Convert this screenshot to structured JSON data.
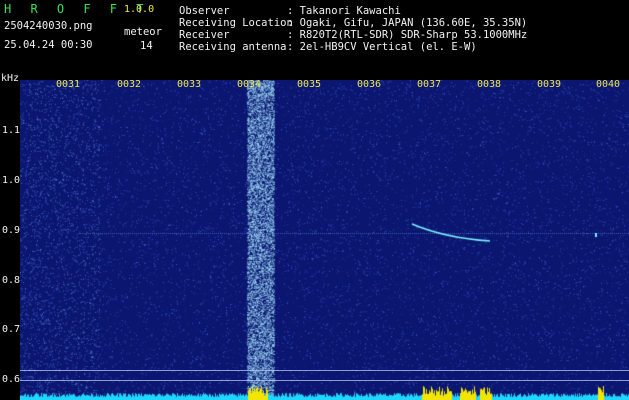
{
  "header": {
    "app_name": "H R O F F T",
    "version": "1.0.0",
    "filename": "2504240030.png",
    "datetime": "25.04.24 00:30",
    "meteor_label": "meteor",
    "meteor_count": "14",
    "fields": [
      {
        "label": "Observer",
        "value": ": Takanori Kawachi"
      },
      {
        "label": "Receiving Location",
        "value": ": Ogaki, Gifu, JAPAN (136.60E, 35.35N)"
      },
      {
        "label": "Receiver",
        "value": ": R820T2(RTL-SDR) SDR-Sharp 53.1000MHz"
      },
      {
        "label": "Receiving antenna",
        "value": ": 2el-HB9CV Vertical (el. E-W)"
      }
    ]
  },
  "plot": {
    "y_unit": "kHz",
    "y_ticks": [
      "1.1",
      "1.0",
      "0.9",
      "0.8",
      "0.7",
      "0.6"
    ],
    "x_ticks": [
      "0031",
      "0032",
      "0033",
      "0034",
      "0035",
      "0036",
      "0037",
      "0038",
      "0039",
      "0040"
    ],
    "colors": {
      "background": "#0a1670",
      "noise": "#5a7cff",
      "signal": "#7cf0ff",
      "band": "#a8e8ff",
      "baseline": "#1fd6ff",
      "peak": "#f2e600"
    }
  }
}
